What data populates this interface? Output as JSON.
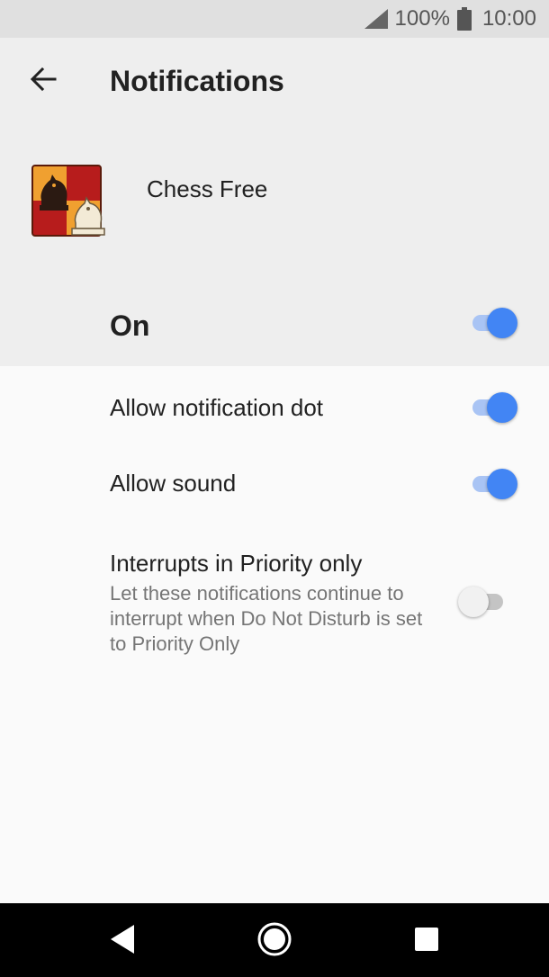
{
  "status_bar": {
    "battery_percent": "100%",
    "time": "10:00",
    "icons": [
      "signal-icon",
      "battery-icon"
    ]
  },
  "header": {
    "back_icon": "back-arrow-icon",
    "title": "Notifications"
  },
  "app": {
    "name": "Chess Free",
    "icon": "chess-app-icon"
  },
  "master_toggle": {
    "label": "On",
    "checked": true
  },
  "settings": [
    {
      "label": "Allow notification dot",
      "checked": true
    },
    {
      "label": "Allow sound",
      "checked": true
    },
    {
      "label": "Interrupts in Priority only",
      "summary": "Let these notifications continue to interrupt when Do Not Disturb is set to Priority Only",
      "checked": false
    }
  ],
  "nav_bar": {
    "icons": [
      "back-triangle-icon",
      "home-circle-icon",
      "recents-square-icon"
    ]
  },
  "colors": {
    "accent": "#4285f4",
    "accent_track": "#a9c4f4",
    "header_bg": "#eeeeee",
    "body_bg": "#fafafa",
    "status_bar_bg": "#e0e0e0",
    "nav_bar_bg": "#000000"
  }
}
